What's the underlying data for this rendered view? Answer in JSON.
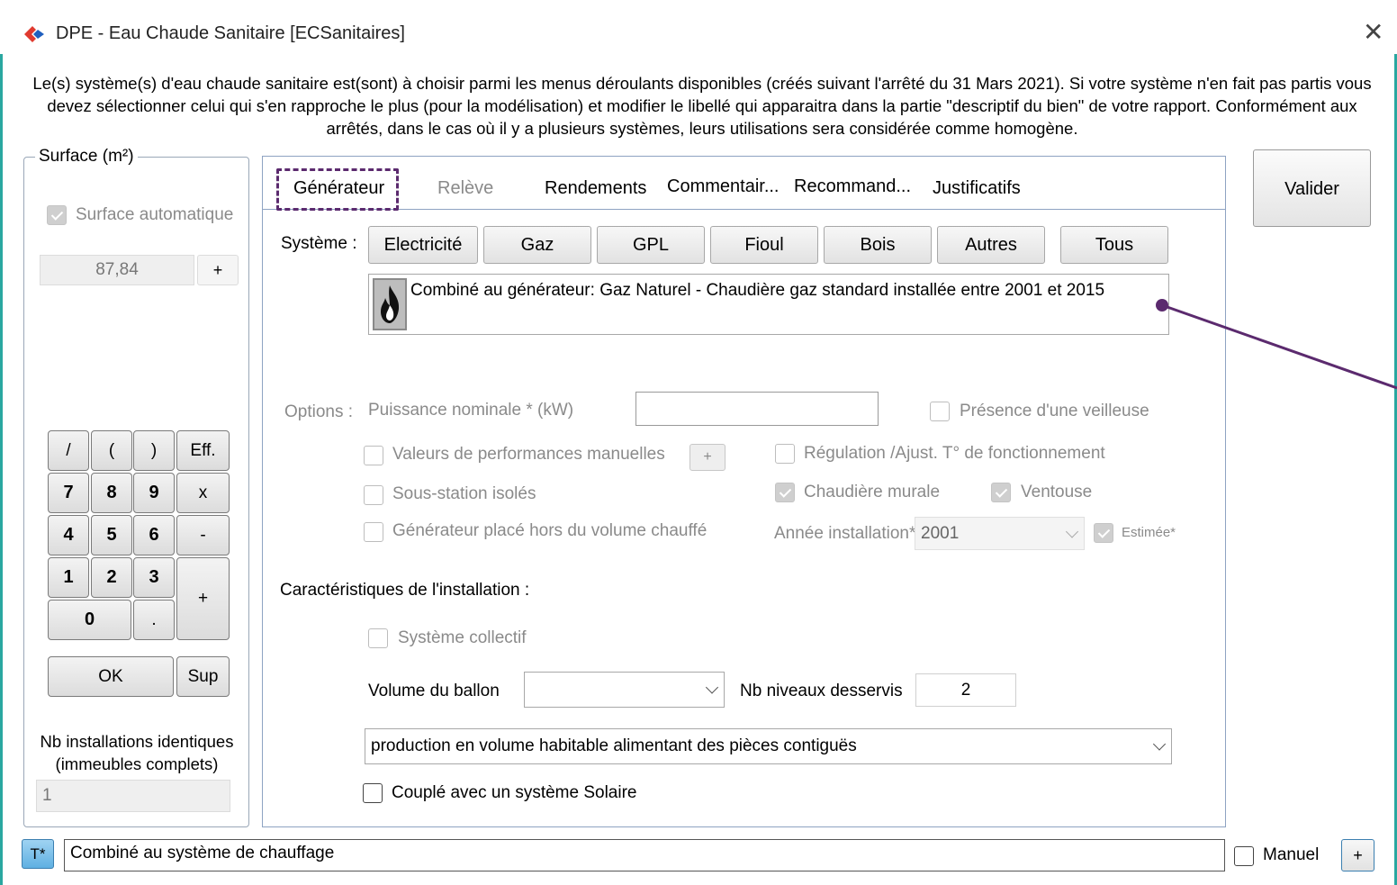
{
  "window": {
    "title": "DPE - Eau Chaude Sanitaire [ECSanitaires]",
    "description": "Le(s) système(s) d'eau chaude sanitaire est(sont) à choisir parmi les menus déroulants disponibles (créés suivant l'arrêté du 31 Mars 2021). Si votre système n'en fait pas partis vous devez sélectionner celui qui s'en rapproche le plus (pour la modélisation) et modifier le libellé qui apparaitra dans la partie \"descriptif du bien\" de votre rapport. Conformément aux arrêtés, dans le cas où il y a plusieurs systèmes, leurs utilisations sera considérée comme homogène.",
    "close": "✕",
    "accent_color": "#2aa7a0",
    "highlight_color": "#5b2a6e"
  },
  "surface": {
    "legend": "Surface (m²)",
    "auto_label": "Surface automatique",
    "value": "87,84",
    "plus": "+",
    "keypad": [
      "/",
      "(",
      ")",
      "Eff.",
      "7",
      "8",
      "9",
      "x",
      "4",
      "5",
      "6",
      "-",
      "1",
      "2",
      "3",
      "+",
      "0",
      ".",
      "OK",
      "Sup"
    ],
    "nb_label": "Nb installations identiques (immeubles complets)",
    "nb_value": "1"
  },
  "tabs": [
    {
      "label": "Générateur",
      "active": true
    },
    {
      "label": "Relève",
      "active": false
    },
    {
      "label": "Rendements",
      "active": false
    },
    {
      "label": "Commentair...",
      "active": false
    },
    {
      "label": "Recommand...",
      "active": false
    },
    {
      "label": "Justificatifs",
      "active": false
    }
  ],
  "systeme": {
    "label": "Système :",
    "buttons": [
      "Electricité",
      "Gaz",
      "GPL",
      "Fioul",
      "Bois",
      "Autres",
      "Tous"
    ],
    "selected": "Combiné au générateur: Gaz Naturel - Chaudière gaz standard installée entre 2001 et 2015",
    "icon": "flame-icon"
  },
  "options": {
    "label": "Options :",
    "puissance_label": "Puissance nominale * (kW)",
    "puissance_value": "",
    "veilleuse": "Présence d'une veilleuse",
    "perf_manuelles": "Valeurs de performances manuelles",
    "perf_plus": "+",
    "regulation": "Régulation /Ajust. T° de fonctionnement",
    "sous_station": "Sous-station isolés",
    "chaudiere_murale": "Chaudière murale",
    "ventouse": "Ventouse",
    "hors_volume": "Générateur placé hors du volume chauffé",
    "annee_label": "Année installation*",
    "annee_value": "2001",
    "estimee": "Estimée*"
  },
  "installation": {
    "title": "Caractéristiques de l'installation :",
    "collectif": "Système collectif",
    "volume_label": "Volume du ballon",
    "volume_value": "",
    "niveaux_label": "Nb niveaux desservis",
    "niveaux_value": "2",
    "production_value": "production en volume habitable alimentant des pièces contiguës",
    "solaire": "Couplé avec un système Solaire"
  },
  "valider": "Valider",
  "bottom": {
    "t_button": "T*",
    "libelle": "Combiné au système de chauffage",
    "manuel": "Manuel",
    "plus": "+"
  }
}
